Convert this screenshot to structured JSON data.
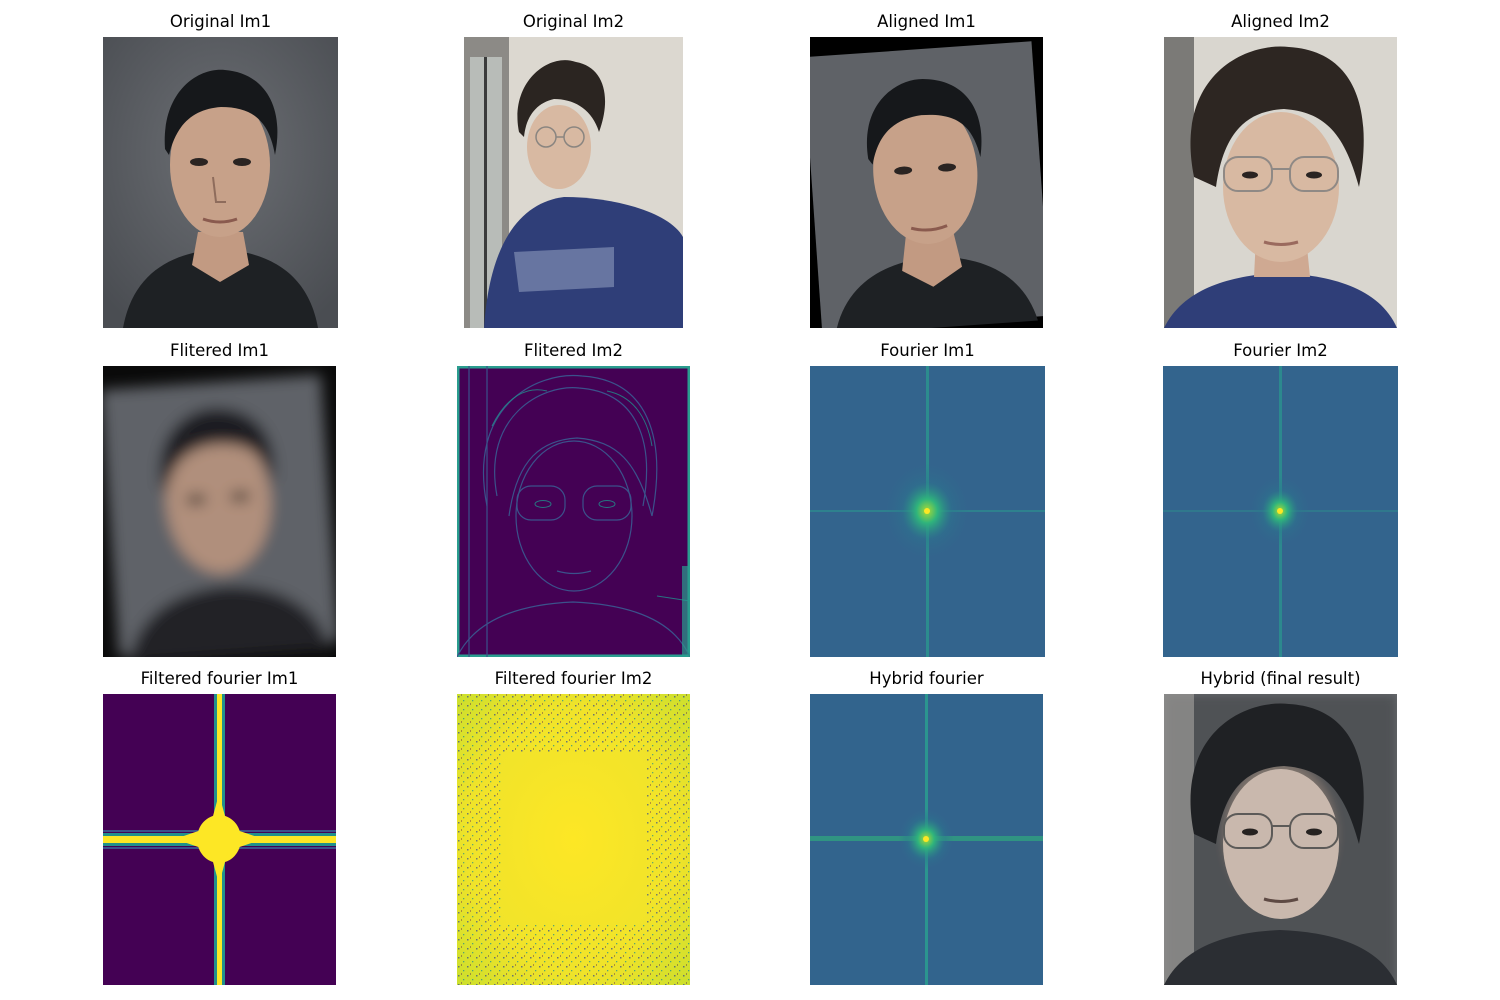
{
  "figure": {
    "titles": {
      "original_im1": "Original Im1",
      "original_im2": "Original Im2",
      "aligned_im1": "Aligned Im1",
      "aligned_im2": "Aligned Im2",
      "filtered_im1": "Flitered Im1",
      "filtered_im2": "Flitered Im2",
      "fourier_im1": "Fourier Im1",
      "fourier_im2": "Fourier Im2",
      "filtered_fourier_im1": "Filtered fourier Im1",
      "filtered_fourier_im2": "Filtered fourier Im2",
      "hybrid_fourier": "Hybrid fourier",
      "hybrid_final": "Hybrid (final result)"
    },
    "colors": {
      "viridis_dark": "#440154",
      "viridis_teal": "#2f6e8e",
      "viridis_yellow": "#fde725",
      "portrait_background": "#5b5e63",
      "room_background": "#d9d6cf",
      "shirt_blue": "#2f3e78"
    }
  }
}
